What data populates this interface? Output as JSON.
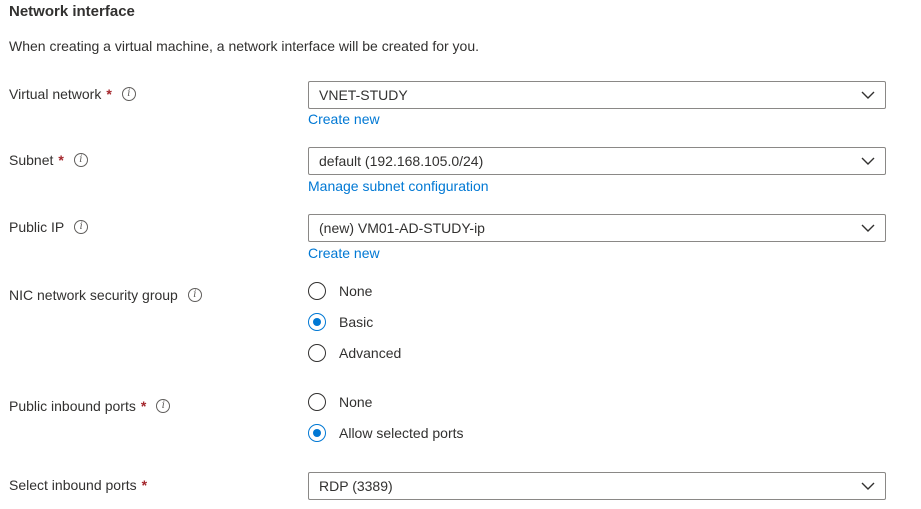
{
  "section": {
    "title": "Network interface",
    "description": "When creating a virtual machine, a network interface will be created for you."
  },
  "virtual_network": {
    "label": "Virtual network",
    "required": "*",
    "value": "VNET-STUDY",
    "link": "Create new"
  },
  "subnet": {
    "label": "Subnet",
    "required": "*",
    "value": "default (192.168.105.0/24)",
    "link": "Manage subnet configuration"
  },
  "public_ip": {
    "label": "Public IP",
    "value": "(new) VM01-AD-STUDY-ip",
    "link": "Create new"
  },
  "nic_nsg": {
    "label": "NIC network security group",
    "options": [
      "None",
      "Basic",
      "Advanced"
    ],
    "selected": "Basic"
  },
  "public_inbound_ports": {
    "label": "Public inbound ports",
    "required": "*",
    "options": [
      "None",
      "Allow selected ports"
    ],
    "selected": "Allow selected ports"
  },
  "select_inbound_ports": {
    "label": "Select inbound ports",
    "required": "*",
    "value": "RDP (3389)"
  },
  "icons": {
    "info": "info-icon",
    "dropdown": "chevron-down-icon"
  },
  "colors": {
    "accent": "#0078d4",
    "required": "#a4262c",
    "text": "#323130",
    "border": "#8a8886"
  }
}
